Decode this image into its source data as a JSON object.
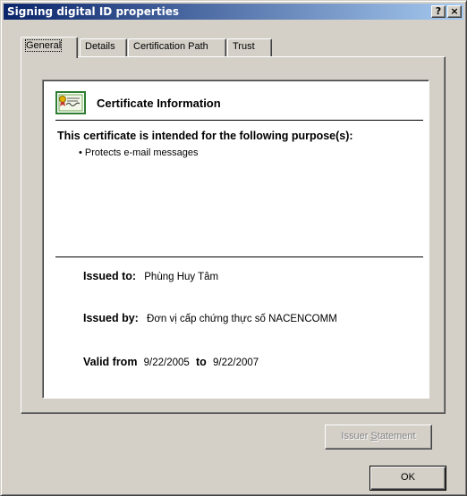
{
  "window": {
    "title": "Signing digital ID properties",
    "help_label": "?",
    "close_label": "×"
  },
  "tabs": [
    {
      "label": "General",
      "active": true
    },
    {
      "label": "Details",
      "active": false
    },
    {
      "label": "Certification Path",
      "active": false
    },
    {
      "label": "Trust",
      "active": false
    }
  ],
  "certificate": {
    "icon": "certificate-icon",
    "title": "Certificate Information",
    "purpose_heading": "This certificate is intended for the following purpose(s):",
    "purposes": [
      "Protects e-mail messages"
    ],
    "issued_to_label": "Issued to:",
    "issued_to_value": "Phùng Huy Tâm",
    "issued_by_label": "Issued by:",
    "issued_by_value": "Đơn vị cấp chứng thực số NACENCOMM",
    "valid_from_label": "Valid from",
    "valid_from_value": "9/22/2005",
    "valid_to_label": "to",
    "valid_to_value": "9/22/2007"
  },
  "buttons": {
    "issuer_statement_prefix": "Issuer ",
    "issuer_statement_mnemonic": "S",
    "issuer_statement_rest": "tatement",
    "ok_label": "OK"
  },
  "colors": {
    "face": "#d4d0c8",
    "title_gradient_start": "#0a246a",
    "title_gradient_end": "#a6caf0",
    "disabled_text": "#808080"
  }
}
